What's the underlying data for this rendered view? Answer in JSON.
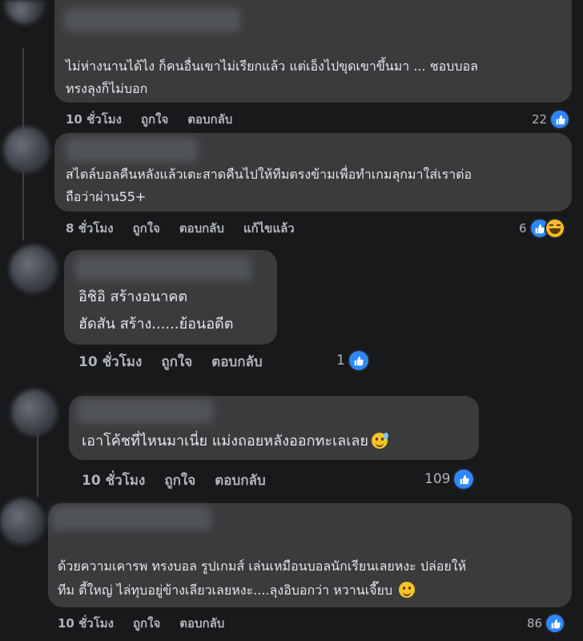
{
  "comments": [
    {
      "text_lines": [
        "ไม่ห่างนานได้ไง ก็คนอื่นเขาไม่เรียกแล้ว แต่เอ็งไปขุดเขาขึ้นมา ... ชอบบอล",
        "ทรงลุงก็ไม่บอก"
      ],
      "time": "10 ชั่วโมง",
      "like": "ถูกใจ",
      "reply": "ตอบกลับ",
      "edited": "",
      "reaction_count": "22"
    },
    {
      "text_lines": [
        "สไตล์บอลคืนหลังแล้วเตะสาดคืนไปให้ทีมตรงข้ามเพื่อทำเกมลุกมาใส่เราต่อ",
        "ถือว่าผ่าน55+"
      ],
      "time": "8 ชั่วโมง",
      "like": "ถูกใจ",
      "reply": "ตอบกลับ",
      "edited": "แก้ไขแล้ว",
      "reaction_count": "6"
    },
    {
      "text_lines": [
        "อิชิอิ สร้างอนาคต",
        "ฮัดสัน สร้าง......ย้อนอดีต"
      ],
      "time": "10 ชั่วโมง",
      "like": "ถูกใจ",
      "reply": "ตอบกลับ",
      "edited": "",
      "reaction_count": "1"
    },
    {
      "text_lines": [
        "เอาโค้ชที่ไหนมาเนี่ย แม่งถอยหลังออกทะเลเลย"
      ],
      "time": "10 ชั่วโมง",
      "like": "ถูกใจ",
      "reply": "ตอบกลับ",
      "edited": "",
      "reaction_count": "109"
    },
    {
      "text_lines": [
        "ด้วยความเคารพ ทรงบอล รูปเกมส์ เล่นเหมือนบอลนักเรียนเลยหงะ ปล่อยให้",
        "ทีม ตี้ใหญ่ ไล่ทุบอยู่ข้างเลียวเลยหงะ....ลุงอิบอกว่า หวานเจี๊ยบ"
      ],
      "time": "10 ชั่วโมง",
      "like": "ถูกใจ",
      "reply": "ตอบกลับ",
      "edited": "",
      "reaction_count": "86"
    }
  ],
  "icons": {
    "like": "like-thumb-icon",
    "haha": "haha-face-icon",
    "emoji_sweat_smile": "grinning-sweat-emoji",
    "emoji_smile": "smiling-face-emoji"
  },
  "colors": {
    "background": "#18191a",
    "bubble": "#3a3b3c",
    "text": "#e4e6eb",
    "meta": "#b0b3b8",
    "like_blue": "#2d88ff"
  }
}
